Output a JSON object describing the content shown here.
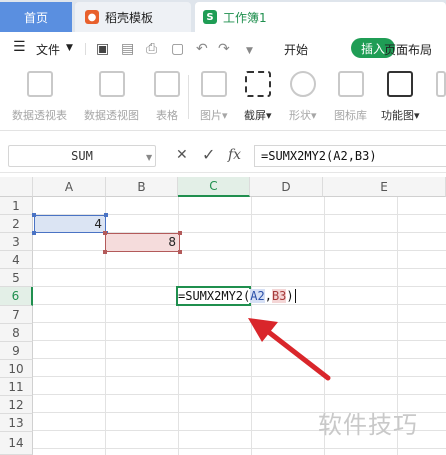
{
  "tabs": [
    {
      "label": "首页"
    },
    {
      "label": "稻壳模板",
      "icon": "docer-icon"
    },
    {
      "label": "工作簿1",
      "icon": "sheet-icon"
    }
  ],
  "menu": {
    "file_label": "文件",
    "items": [
      "开始",
      "插入",
      "页面布局"
    ],
    "active": "插入"
  },
  "ribbon": {
    "buttons": [
      {
        "label": "数据透视表",
        "icon": "pivot-table-icon"
      },
      {
        "label": "数据透视图",
        "icon": "pivot-chart-icon"
      },
      {
        "label": "表格",
        "icon": "table-icon"
      },
      {
        "label": "图片▾",
        "icon": "picture-icon"
      },
      {
        "label": "截屏▾",
        "icon": "screenshot-icon"
      },
      {
        "label": "形状▾",
        "icon": "shapes-icon"
      },
      {
        "label": "图标库",
        "icon": "icon-library-icon"
      },
      {
        "label": "功能图▾",
        "icon": "function-chart-icon"
      }
    ]
  },
  "formula_bar": {
    "name_box": "SUM",
    "cancel_glyph": "✕",
    "confirm_glyph": "✓",
    "fx_label": "fx",
    "formula": "=SUMX2MY2(A2,B3)"
  },
  "grid": {
    "columns": [
      "A",
      "B",
      "C",
      "D",
      "E"
    ],
    "rows": [
      "1",
      "2",
      "3",
      "4",
      "5",
      "6",
      "7",
      "8",
      "9",
      "10",
      "11",
      "12",
      "13",
      "14"
    ],
    "active_column": "C",
    "active_row": "6",
    "cells": {
      "A2": "4",
      "B3": "8",
      "C6_prefix": "=SUMX2MY2(",
      "C6_ref1": "A2",
      "C6_sep": ",",
      "C6_ref2": "B3",
      "C6_suffix": ")"
    }
  },
  "watermark": "软件技巧",
  "colors": {
    "accent_green": "#1f8f4e",
    "ref_blue": "#4a73c4",
    "ref_red": "#b35a5a",
    "arrow_red": "#d9262b"
  }
}
